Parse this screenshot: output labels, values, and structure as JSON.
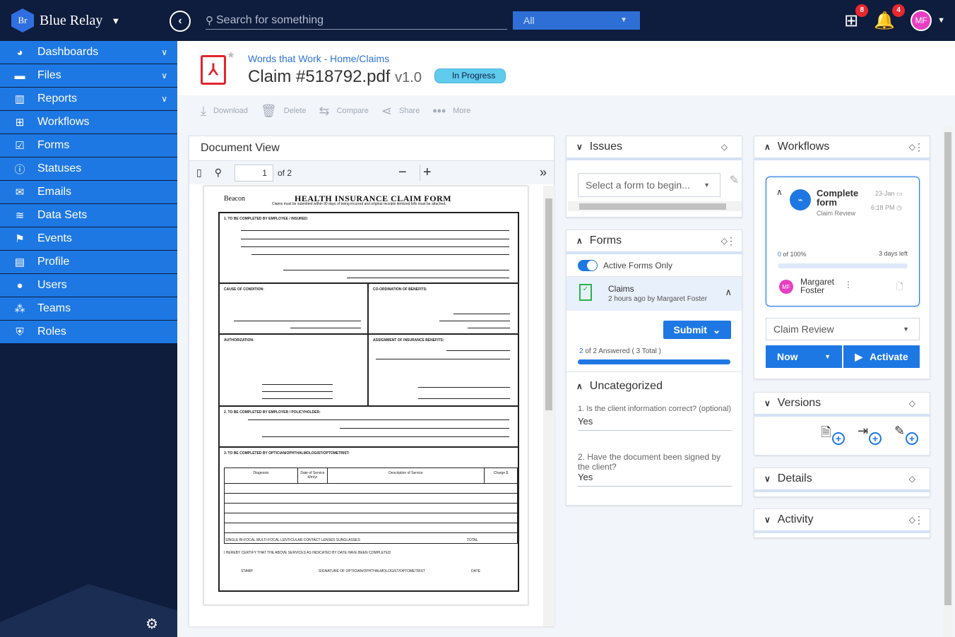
{
  "app": {
    "name": "Blue Relay",
    "logo": "Br"
  },
  "topbar": {
    "search_placeholder": "Search for something",
    "scope": "All",
    "workflow_badge": "8",
    "notif_badge": "4",
    "user_initials": "MF"
  },
  "sidebar": {
    "items": [
      {
        "label": "Dashboards",
        "icon": "dashboard-icon",
        "dd": true
      },
      {
        "label": "Files",
        "icon": "folder-icon",
        "dd": true
      },
      {
        "label": "Reports",
        "icon": "chart-icon",
        "dd": true
      },
      {
        "label": "Workflows",
        "icon": "workflow-icon"
      },
      {
        "label": "Forms",
        "icon": "checkbox-icon"
      },
      {
        "label": "Statuses",
        "icon": "info-icon"
      },
      {
        "label": "Emails",
        "icon": "mail-icon"
      },
      {
        "label": "Data Sets",
        "icon": "database-icon"
      },
      {
        "label": "Events",
        "icon": "flag-icon"
      },
      {
        "label": "Profile",
        "icon": "id-card-icon"
      },
      {
        "label": "Users",
        "icon": "user-icon"
      },
      {
        "label": "Teams",
        "icon": "team-icon"
      },
      {
        "label": "Roles",
        "icon": "shield-icon"
      }
    ]
  },
  "header": {
    "breadcrumb": "Words that Work - Home/Claims",
    "title": "Claim #518792.pdf",
    "version": "v1.0",
    "status": "In Progress"
  },
  "toolbar": {
    "download": "Download",
    "delete": "Delete",
    "compare": "Compare",
    "share": "Share",
    "more": "More"
  },
  "docview": {
    "title": "Document View",
    "page": "1",
    "of": "of 2"
  },
  "form": {
    "title": "HEALTH INSURANCE CLAIM FORM",
    "subtitle": "Claims must be submitted within 90 days of being incurred and original receipts itemized bills must be attached.",
    "brand": "Beacon",
    "s1": "1.   TO BE COMPLETED BY EMPLOYEE / INSURED:",
    "s2a": "CAUSE OF CONDITION:",
    "s2b": "CO-ORDINATION OF BENEFITS:",
    "s3a": "AUTHORIZATION:",
    "s3b": "ASSIGNMENT OF INSURANCE BENEFITS:",
    "s4": "2. TO BE COMPLETED BY EMPLOYER / POLICYHOLDER:",
    "s5": "3. TO BE COMPLETED BY OPTICIAN/OPHTHALMOLOGIST/OPTOMETRIST:",
    "cols": [
      "Diagnosis",
      "Date of Service d/m/yr",
      "Description of Service",
      "Charge $"
    ],
    "opts": "SINGLE   BI-FOCAL   MULTI-FOCAL   LENTICULAR   CONTACT LENSES   SUNGLASSES",
    "total": "TOTAL",
    "certify": "I HEREBY CERTIFY THAT THE ABOVE SERVICES AS INDICATED BY DATE HAVE BEEN COMPLETED",
    "stamp": "STAMP",
    "sig": "SIGNATURE OF OPTICIAN/OPHTHALMOLOGIST/OPTOMETRIST",
    "date": "DATE"
  },
  "issues": {
    "title": "Issues",
    "select": "Select a form to begin..."
  },
  "forms": {
    "title": "Forms",
    "toggle": "Active Forms Only",
    "claim": "Claims",
    "claim_sub": "2 hours ago by Margaret Foster",
    "submit": "Submit",
    "answered_n": "2",
    "answered": "of 2 Answered  ( 3 Total )",
    "uncat": "Uncategorized",
    "q1": "1. Is the client information correct?  (optional)",
    "a1": "Yes",
    "q2": "2. Have the document been signed by the client?",
    "a2": "Yes"
  },
  "workflows": {
    "title": "Workflows",
    "card_title": "Complete form",
    "card_sub": "Claim Review",
    "date": "23-Jan",
    "time": "6:18 PM",
    "pct_n": "0",
    "pct": "of 100%",
    "left": "3 days left",
    "user": "Margaret Foster",
    "user_initials": "MF",
    "select": "Claim Review",
    "now": "Now",
    "activate": "Activate"
  },
  "versions": {
    "title": "Versions"
  },
  "details": {
    "title": "Details"
  },
  "activity": {
    "title": "Activity"
  }
}
